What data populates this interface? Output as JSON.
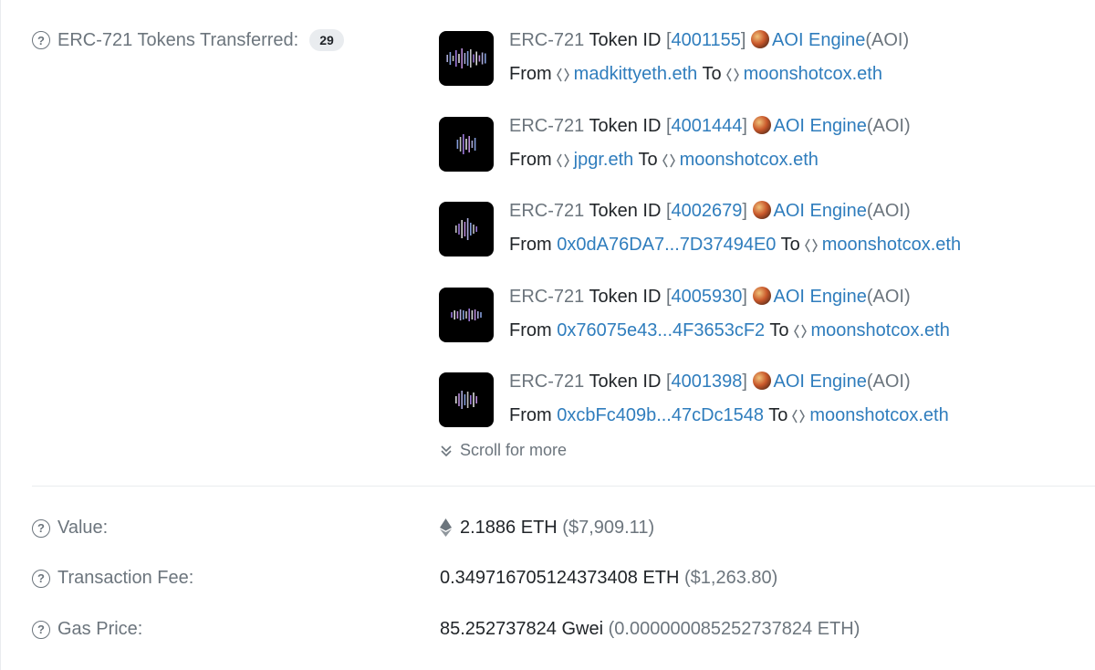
{
  "tokens_transferred": {
    "label": "ERC-721 Tokens Transferred:",
    "count": "29",
    "items": [
      {
        "standard": "ERC-721",
        "token_id_label": "Token ID",
        "token_id": "4001155",
        "collection": "AOI Engine",
        "symbol": "(AOI)",
        "from_label": "From",
        "from": "madkittyeth.eth",
        "from_is_ens": true,
        "to_label": "To",
        "to": "moonshotcox.eth"
      },
      {
        "standard": "ERC-721",
        "token_id_label": "Token ID",
        "token_id": "4001444",
        "collection": "AOI Engine",
        "symbol": "(AOI)",
        "from_label": "From",
        "from": "jpgr.eth",
        "from_is_ens": true,
        "to_label": "To",
        "to": "moonshotcox.eth"
      },
      {
        "standard": "ERC-721",
        "token_id_label": "Token ID",
        "token_id": "4002679",
        "collection": "AOI Engine",
        "symbol": "(AOI)",
        "from_label": "From",
        "from": "0x0dA76DA7...7D37494E0",
        "from_is_ens": false,
        "to_label": "To",
        "to": "moonshotcox.eth"
      },
      {
        "standard": "ERC-721",
        "token_id_label": "Token ID",
        "token_id": "4005930",
        "collection": "AOI Engine",
        "symbol": "(AOI)",
        "from_label": "From",
        "from": "0x76075e43...4F3653cF2",
        "from_is_ens": false,
        "to_label": "To",
        "to": "moonshotcox.eth"
      },
      {
        "standard": "ERC-721",
        "token_id_label": "Token ID",
        "token_id": "4001398",
        "collection": "AOI Engine",
        "symbol": "(AOI)",
        "from_label": "From",
        "from": "0xcbFc409b...47cDc1548",
        "from_is_ens": false,
        "to_label": "To",
        "to": "moonshotcox.eth"
      }
    ],
    "scroll_more": "Scroll for more"
  },
  "value": {
    "label": "Value:",
    "amount": "2.1886 ETH",
    "usd": "($7,909.11)"
  },
  "transaction_fee": {
    "label": "Transaction Fee:",
    "amount": "0.349716705124373408 ETH",
    "usd": "($1,263.80)"
  },
  "gas_price": {
    "label": "Gas Price:",
    "amount": "85.252737824 Gwei",
    "eth": "(0.000000085252737824 ETH)"
  },
  "icons": {
    "help": "question-circle-icon",
    "ens": "ens-diamond-icon",
    "eth": "ethereum-icon",
    "scroll": "double-chevron-down-icon",
    "collection": "aoi-engine-token-icon"
  },
  "colors": {
    "link": "#2f7dbd",
    "muted": "#6c757d",
    "text": "#212529",
    "badge_bg": "#e9ecef",
    "thumb_bg": "#000000"
  }
}
